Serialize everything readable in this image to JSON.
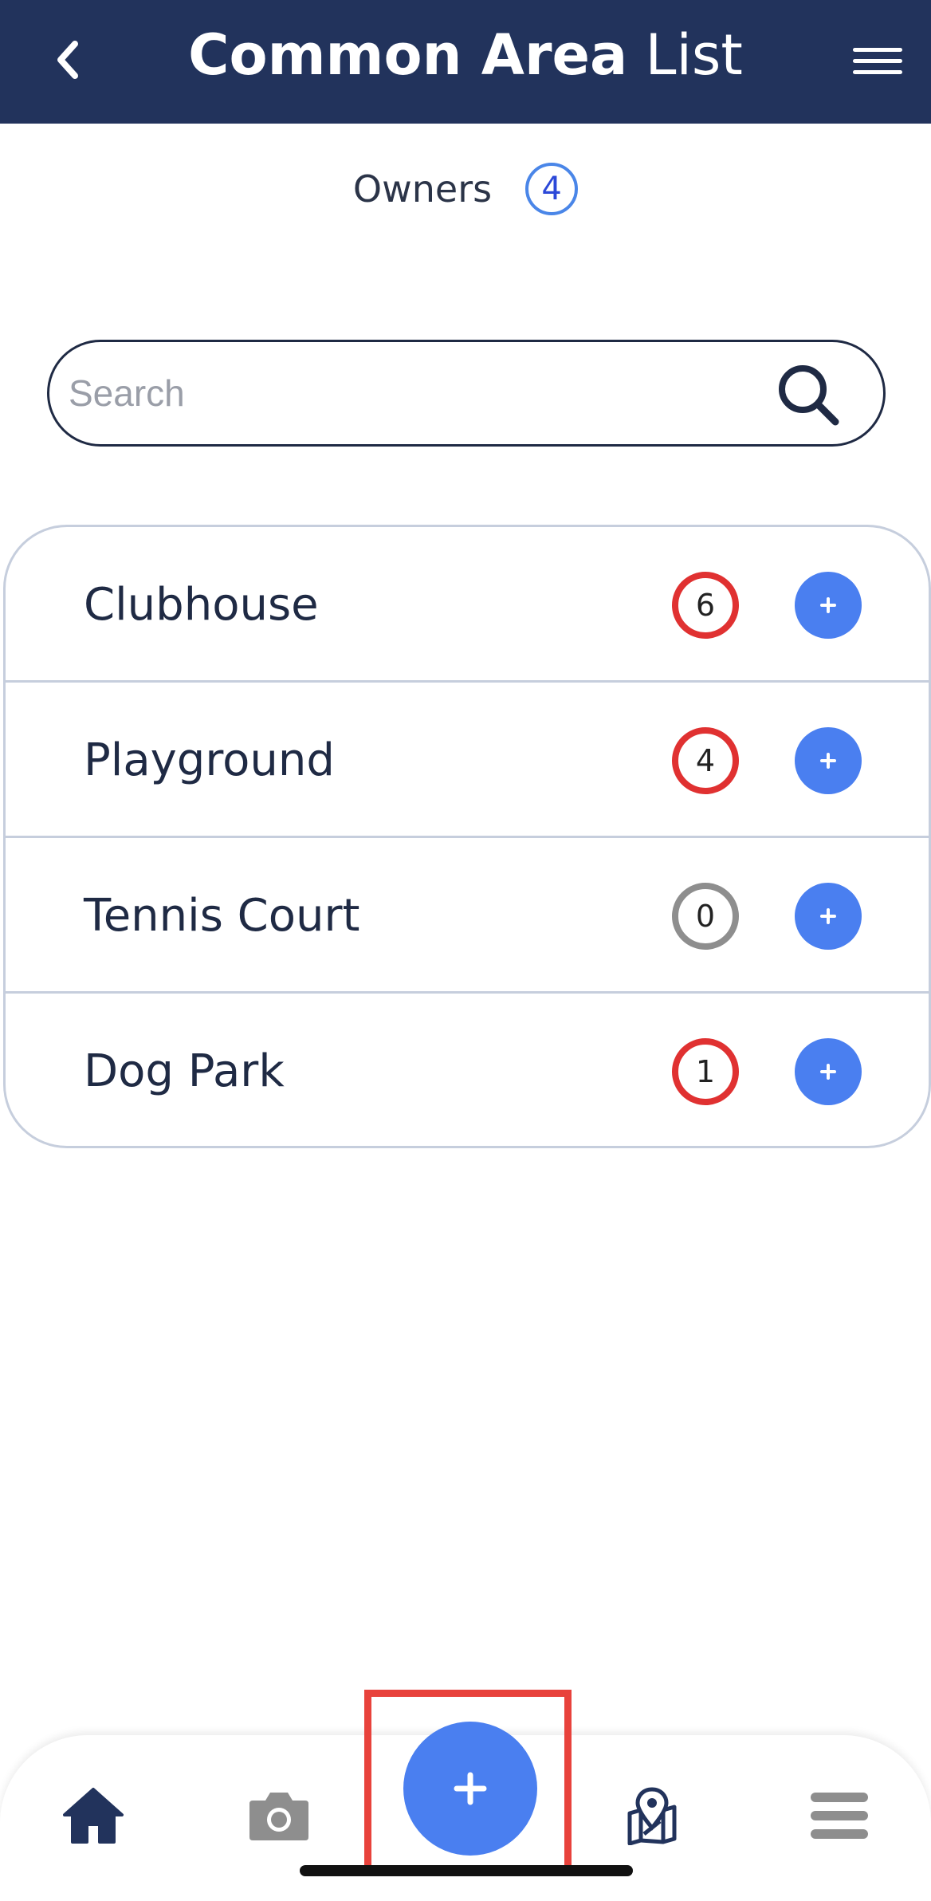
{
  "header": {
    "title_bold": "Common Area",
    "title_light": "List"
  },
  "owners": {
    "label": "Owners",
    "count": "4"
  },
  "search": {
    "placeholder": "Search"
  },
  "areas": [
    {
      "name": "Clubhouse",
      "count": "6",
      "status": "active"
    },
    {
      "name": "Playground",
      "count": "4",
      "status": "active"
    },
    {
      "name": "Tennis Court",
      "count": "0",
      "status": "empty"
    },
    {
      "name": "Dog Park",
      "count": "1",
      "status": "active"
    }
  ],
  "tabbar": {
    "items": [
      "home-icon",
      "camera-icon",
      "add-icon",
      "map-pin-icon",
      "menu-icon"
    ]
  },
  "colors": {
    "header_bg": "#22335c",
    "accent_blue": "#4a7ff0",
    "count_red": "#e03131",
    "count_gray": "#8e8e8e",
    "highlight_red": "#e8423c"
  }
}
